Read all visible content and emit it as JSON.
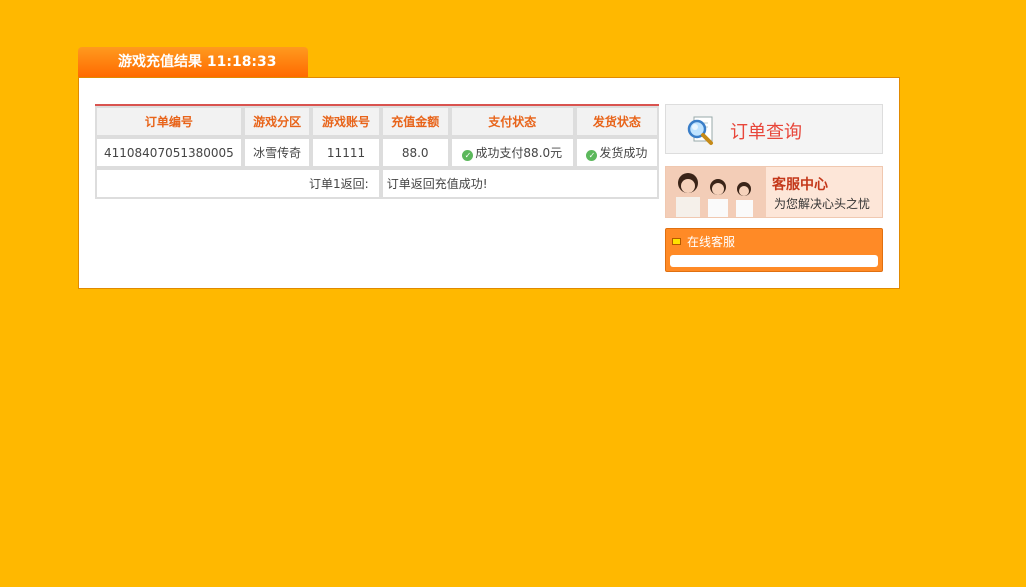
{
  "header": {
    "title": "游戏充值结果 11:18:33"
  },
  "table": {
    "columns": [
      "订单编号",
      "游戏分区",
      "游戏账号",
      "充值金额",
      "支付状态",
      "发货状态"
    ],
    "row": {
      "order_id": "41108407051380005",
      "zone": "冰雪传奇",
      "account": "11111",
      "amount": "88.0",
      "pay_status": "成功支付88.0元",
      "ship_status": "发货成功"
    },
    "return_label": "订单1返回:",
    "return_message": "订单返回充值成功!"
  },
  "sidebar": {
    "query_label": "订单查询",
    "service_title": "客服中心",
    "service_subtitle": "为您解决心头之忧",
    "online_label": "在线客服"
  },
  "colors": {
    "background": "#FFB800",
    "accent": "#FF6A00",
    "header_text": "#E8641A"
  }
}
